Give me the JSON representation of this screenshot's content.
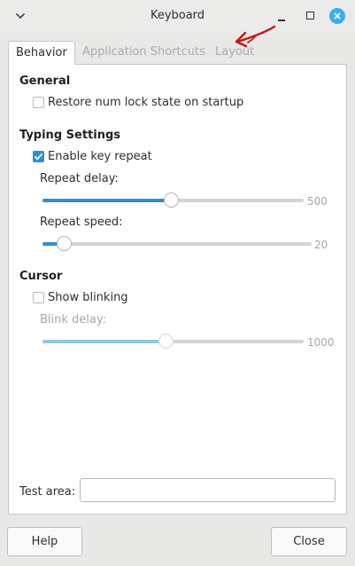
{
  "window": {
    "title": "Keyboard"
  },
  "tabs": [
    {
      "label": "Behavior",
      "active": true
    },
    {
      "label": "Application Shortcuts",
      "active": false
    },
    {
      "label": "Layout",
      "active": false
    }
  ],
  "general": {
    "heading": "General",
    "restore_numlock": {
      "label": "Restore num lock state on startup",
      "checked": false
    }
  },
  "typing": {
    "heading": "Typing Settings",
    "key_repeat": {
      "label": "Enable key repeat",
      "checked": true
    },
    "repeat_delay": {
      "label": "Repeat delay:",
      "value": "500",
      "fraction": 0.49
    },
    "repeat_speed": {
      "label": "Repeat speed:",
      "value": "20",
      "fraction": 0.08
    }
  },
  "cursor": {
    "heading": "Cursor",
    "show_blinking": {
      "label": "Show blinking",
      "checked": false
    },
    "blink_delay": {
      "label": "Blink delay:",
      "value": "1000",
      "fraction": 0.47
    }
  },
  "test_area": {
    "label": "Test area:",
    "value": ""
  },
  "buttons": {
    "help": "Help",
    "close": "Close"
  },
  "colors": {
    "accent": "#2b8fd6",
    "close_button": "#3daee9",
    "annotation": "#cc1111"
  }
}
